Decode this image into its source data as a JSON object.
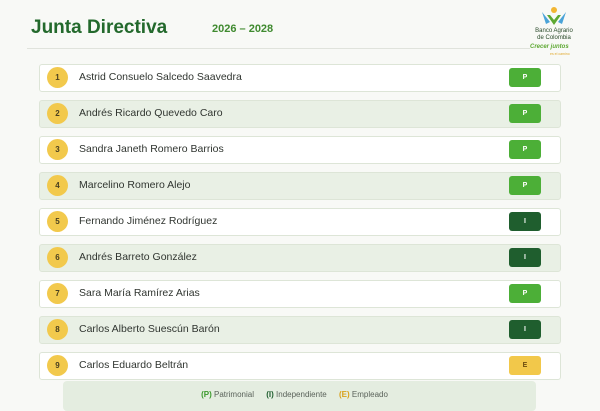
{
  "header": {
    "title": "Junta Directiva",
    "period": "2026 – 2028"
  },
  "logo": {
    "name_line1": "Banco Agrario",
    "name_line2": "de Colombia",
    "tagline": "Crecer juntos",
    "subline": "es el camino"
  },
  "members": [
    {
      "number": "1",
      "name": "Astrid Consuelo Salcedo Saavedra",
      "type": "P"
    },
    {
      "number": "2",
      "name": "Andrés Ricardo Quevedo Caro",
      "type": "P"
    },
    {
      "number": "3",
      "name": "Sandra Janeth Romero Barrios",
      "type": "P"
    },
    {
      "number": "4",
      "name": "Marcelino Romero Alejo",
      "type": "P"
    },
    {
      "number": "5",
      "name": "Fernando Jiménez Rodríguez",
      "type": "I"
    },
    {
      "number": "6",
      "name": "Andrés Barreto González",
      "type": "I"
    },
    {
      "number": "7",
      "name": "Sara María Ramírez Arias",
      "type": "P"
    },
    {
      "number": "8",
      "name": "Carlos Alberto Suescún Barón",
      "type": "I"
    },
    {
      "number": "9",
      "name": "Carlos Eduardo Beltrán",
      "type": "E"
    }
  ],
  "legend": {
    "p_code": "(P)",
    "p_label": "Patrimonial",
    "i_code": "(I)",
    "i_label": "Independiente",
    "e_code": "(E)",
    "e_label": "Empleado"
  },
  "colors": {
    "title_green": "#23692c",
    "patrimonial": "#4caf37",
    "independiente": "#1f5e2e",
    "empleado": "#f2c84a",
    "number_circle": "#f2c94c"
  }
}
